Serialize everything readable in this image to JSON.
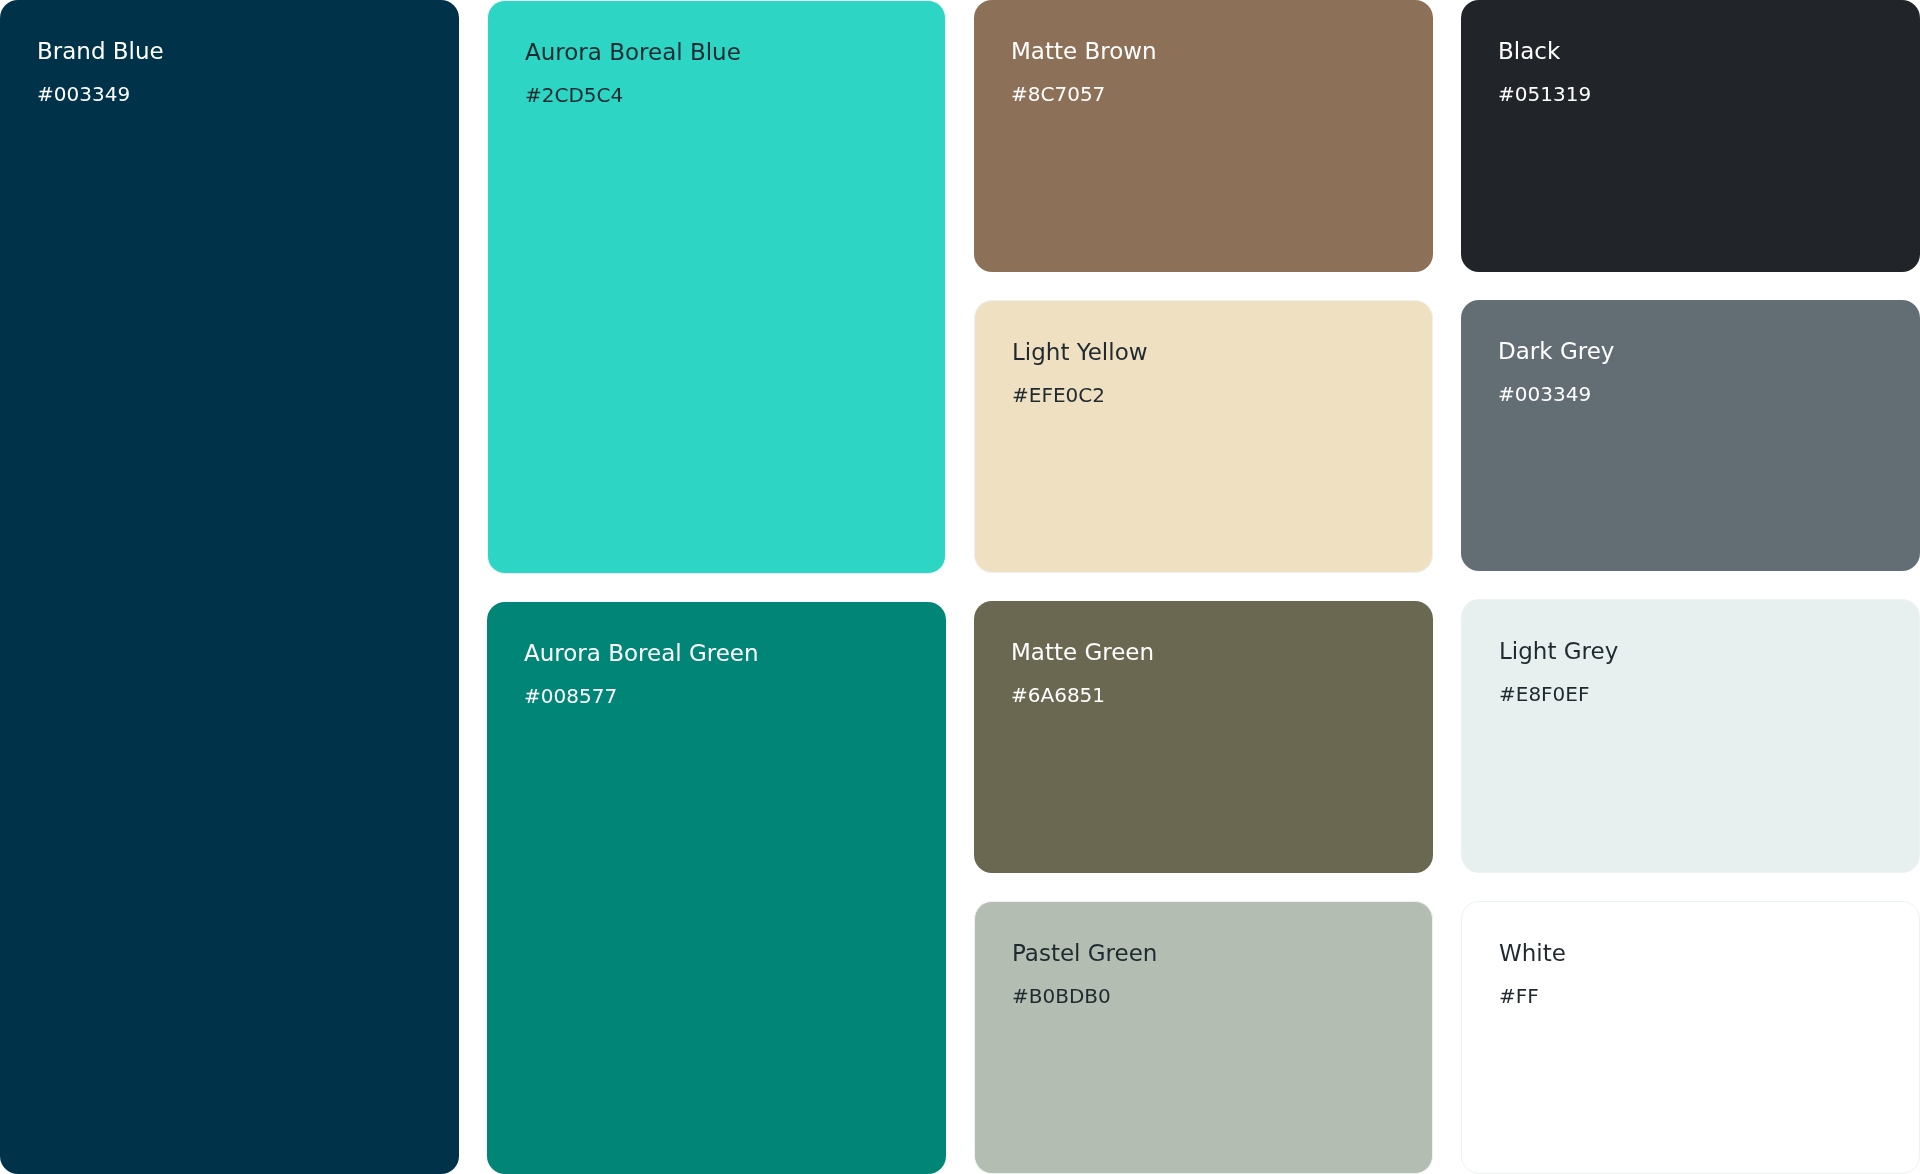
{
  "columns": [
    {
      "swatches": [
        {
          "name": "Brand Blue",
          "hex": "#003349",
          "color": "#003349"
        }
      ]
    },
    {
      "swatches": [
        {
          "name": "Aurora Boreal Blue",
          "hex": "#2CD5C4",
          "color": "#2cd5c4"
        },
        {
          "name": "Aurora Boreal Green",
          "hex": "#008577",
          "color": "#008577"
        }
      ]
    },
    {
      "swatches": [
        {
          "name": "Matte Brown",
          "hex": "#8C7057",
          "color": "#8c7057"
        },
        {
          "name": "Light Yellow",
          "hex": "#EFE0C2",
          "color": "#efe0c2"
        },
        {
          "name": "Matte Green",
          "hex": "#6A6851",
          "color": "#6a6851"
        },
        {
          "name": "Pastel Green",
          "hex": "#B0BDB0",
          "color": "#b3bdb1"
        }
      ]
    },
    {
      "swatches": [
        {
          "name": "Black",
          "hex": "#051319",
          "color": "#212529"
        },
        {
          "name": "Dark Grey",
          "hex": "#003349",
          "color": "#636e74"
        },
        {
          "name": "Light Grey",
          "hex": "#E8F0EF",
          "color": "#e8f0ef"
        },
        {
          "name": "White",
          "hex": "#FF",
          "color": "#ffffff"
        }
      ]
    }
  ]
}
